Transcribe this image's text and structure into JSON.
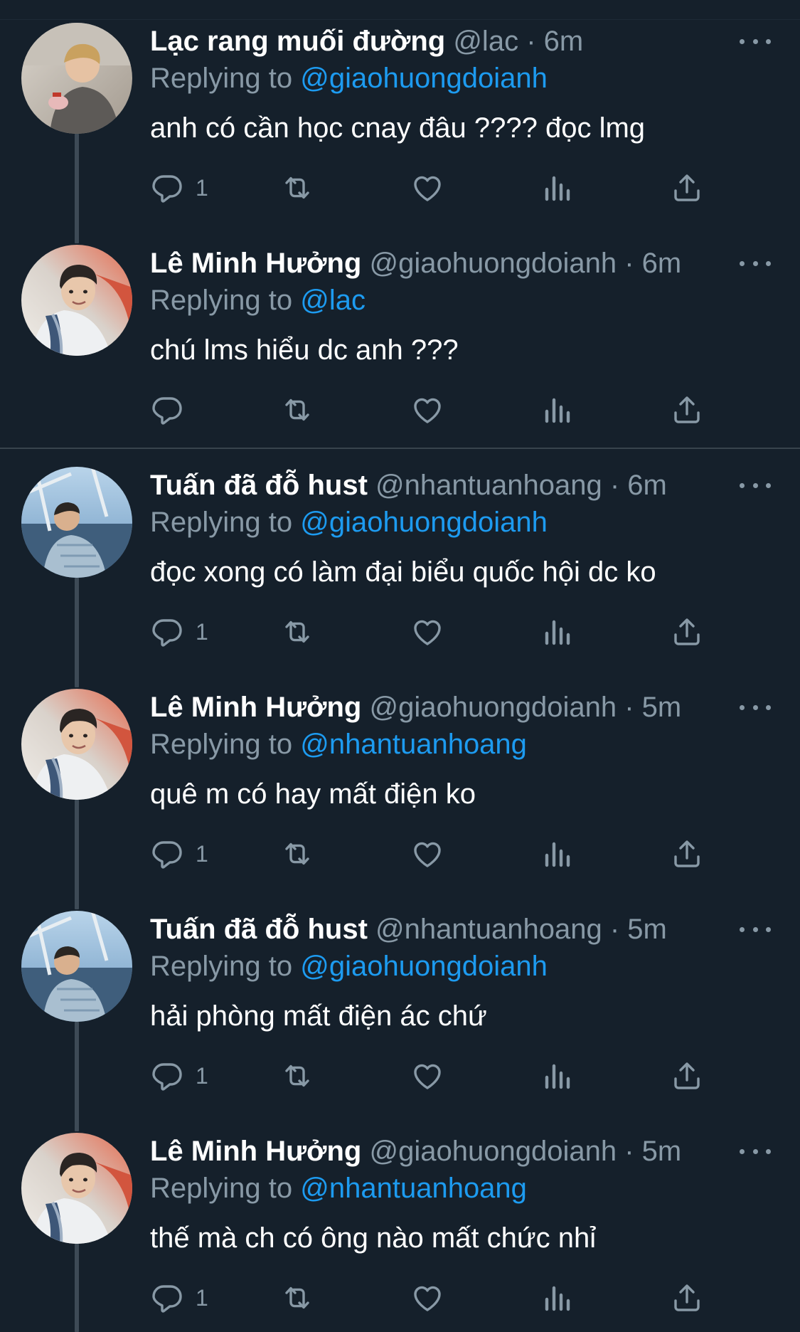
{
  "tweets": [
    {
      "name": "Lạc rang muối đường",
      "handle": "@lac",
      "time": "· 6m",
      "replying_label": "Replying to",
      "replying_to": "@giaohuongdoianh",
      "text": "anh có cần học cnay đâu ???? đọc lmg",
      "reply_count": "1",
      "avatar": "avatar-photo-person-sitting"
    },
    {
      "name": "Lê Minh Hưởng",
      "handle": "@giaohuongdoianh",
      "time": "· 6m",
      "replying_label": "Replying to",
      "replying_to": "@lac",
      "text": "chú lms hiểu dc anh ???",
      "reply_count": "",
      "avatar": "avatar-photo-person-scarf"
    },
    {
      "name": "Tuấn đã đỗ hust",
      "handle": "@nhantuanhoang",
      "time": "· 6m",
      "replying_label": "Replying to",
      "replying_to": "@giaohuongdoianh",
      "text": "đọc xong có làm đại biểu quốc hội dc ko",
      "reply_count": "1",
      "avatar": "avatar-photo-person-boat"
    },
    {
      "name": "Lê Minh Hưởng",
      "handle": "@giaohuongdoianh",
      "time": "· 5m",
      "replying_label": "Replying to",
      "replying_to": "@nhantuanhoang",
      "text": "quê m có hay mất điện ko",
      "reply_count": "1",
      "avatar": "avatar-photo-person-scarf"
    },
    {
      "name": "Tuấn đã đỗ hust",
      "handle": "@nhantuanhoang",
      "time": "· 5m",
      "replying_label": "Replying to",
      "replying_to": "@giaohuongdoianh",
      "text": "hải phòng mất điện ác chứ",
      "reply_count": "1",
      "avatar": "avatar-photo-person-boat"
    },
    {
      "name": "Lê Minh Hưởng",
      "handle": "@giaohuongdoianh",
      "time": "· 5m",
      "replying_label": "Replying to",
      "replying_to": "@nhantuanhoang",
      "text": "thế mà ch có ông nào mất chức nhỉ",
      "reply_count": "1",
      "avatar": "avatar-photo-person-scarf"
    }
  ],
  "icons": {
    "reply": "reply-icon",
    "retweet": "retweet-icon",
    "like": "heart-icon",
    "views": "analytics-icon",
    "share": "share-icon",
    "more": "more-icon"
  },
  "colors": {
    "background": "#15202b",
    "muted": "#8899a6",
    "mention": "#1d9bf0",
    "thread_line": "#3d4a56",
    "divider": "#38444d"
  }
}
